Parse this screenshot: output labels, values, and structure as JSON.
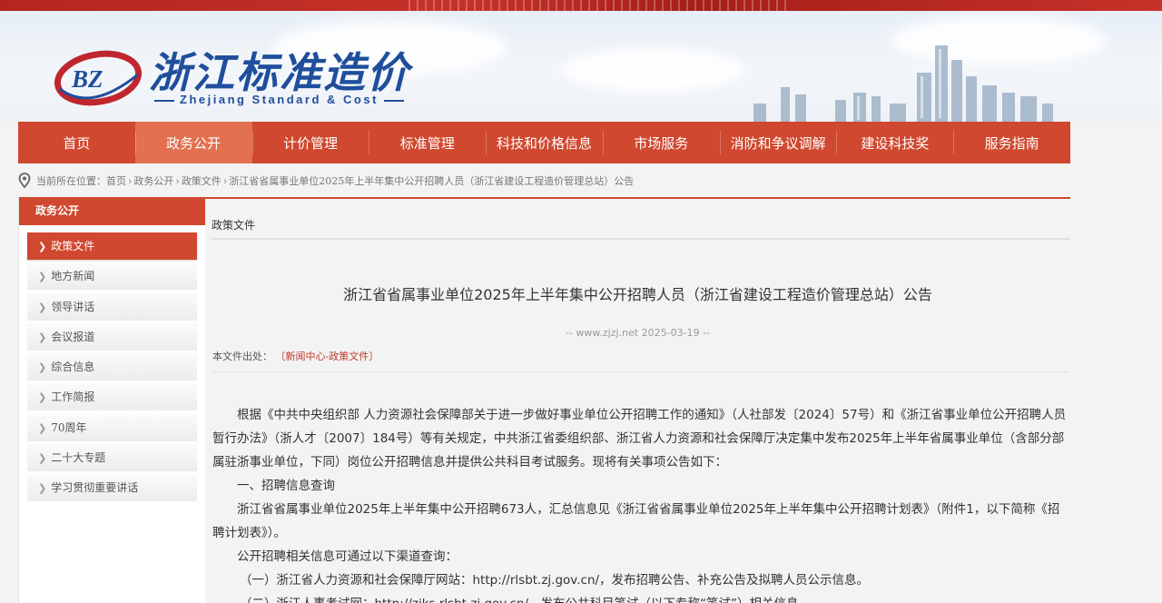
{
  "site": {
    "logo_initials": "BZ",
    "logo_title": "浙江标准造价",
    "logo_subtitle": "Zhejiang Standard & Cost"
  },
  "colors": {
    "brand_red": "#d0482f",
    "nav_active": "#e3704f",
    "logo_blue": "#1f4e9c"
  },
  "nav": {
    "items": [
      {
        "label": "首页"
      },
      {
        "label": "政务公开",
        "active": true
      },
      {
        "label": "计价管理"
      },
      {
        "label": "标准管理"
      },
      {
        "label": "科技和价格信息"
      },
      {
        "label": "市场服务"
      },
      {
        "label": "消防和争议调解"
      },
      {
        "label": "建设科技奖"
      },
      {
        "label": "服务指南"
      }
    ]
  },
  "breadcrumb": {
    "prefix": "当前所在位置：",
    "items": [
      "首页",
      "政务公开",
      "政策文件",
      "浙江省省属事业单位2025年上半年集中公开招聘人员（浙江省建设工程造价管理总站）公告"
    ]
  },
  "sidebar": {
    "title": "政务公开",
    "items": [
      {
        "label": "政策文件",
        "active": true
      },
      {
        "label": "地方新闻"
      },
      {
        "label": "领导讲话"
      },
      {
        "label": "会议报道"
      },
      {
        "label": "综合信息"
      },
      {
        "label": "工作简报"
      },
      {
        "label": "70周年"
      },
      {
        "label": "二十大专题"
      },
      {
        "label": "学习贯彻重要讲话"
      }
    ]
  },
  "main": {
    "section_title": "政策文件",
    "article_title": "浙江省省属事业单位2025年上半年集中公开招聘人员（浙江省建设工程造价管理总站）公告",
    "meta": "-- www.zjzj.net 2025-03-19 --",
    "source_label": "本文件出处：",
    "source_link": "〔新闻中心-政策文件〕",
    "paragraphs": [
      "根据《中共中央组织部 人力资源社会保障部关于进一步做好事业单位公开招聘工作的通知》（人社部发〔2024〕57号）和《浙江省事业单位公开招聘人员暂行办法》（浙人才〔2007〕184号）等有关规定，中共浙江省委组织部、浙江省人力资源和社会保障厅决定集中发布2025年上半年省属事业单位（含部分部属驻浙事业单位，下同）岗位公开招聘信息并提供公共科目考试服务。现将有关事项公告如下：",
      "一、招聘信息查询",
      "浙江省省属事业单位2025年上半年集中公开招聘673人，汇总信息见《浙江省省属事业单位2025年上半年集中公开招聘计划表》（附件1，以下简称《招聘计划表》）。",
      "公开招聘相关信息可通过以下渠道查询：",
      "（一）浙江省人力资源和社会保障厅网站：http://rlsbt.zj.gov.cn/，发布招聘公告、补充公告及拟聘人员公示信息。",
      "（二）浙江人事考试网：http://zjks.rlsbt.zj.gov.cn/，发布公共科目笔试（以下专称“笔试”）相关信息。"
    ]
  }
}
